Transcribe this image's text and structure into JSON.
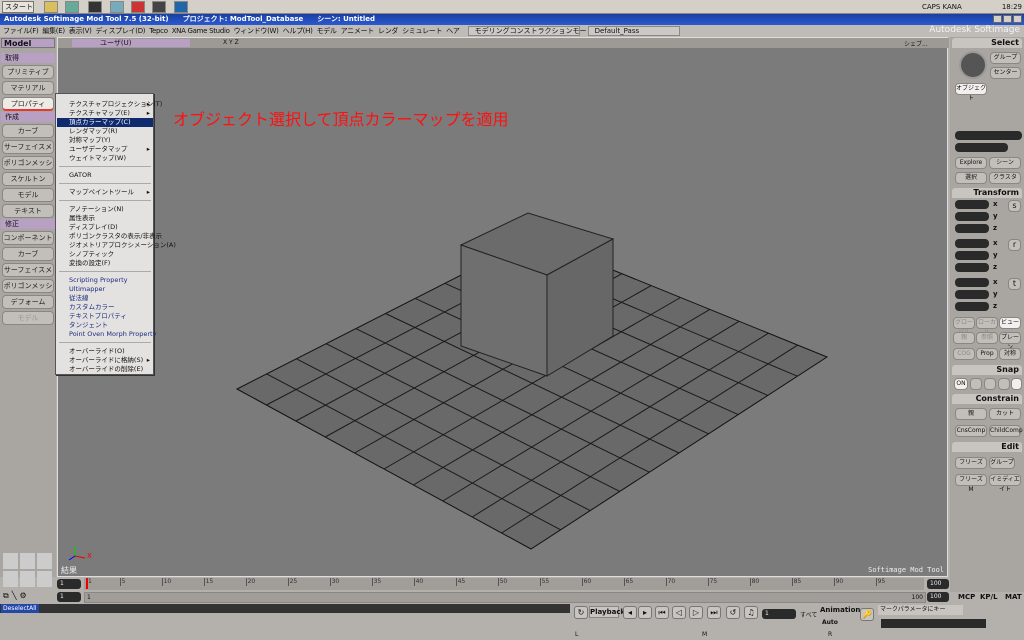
{
  "taskbar": {
    "start": "スタート",
    "time": "18:29",
    "tray": "CAPS KANA"
  },
  "titlebar": {
    "app": "Autodesk Softimage Mod Tool 7.5 (32-bit)",
    "project": "プロジェクト: ModTool_Database",
    "scene": "シーン: Untitled"
  },
  "menubar": {
    "items": [
      "ファイル(F)",
      "編集(E)",
      "表示(V)",
      "ディスプレイ(D)",
      "Tepco",
      "XNA Game Studio",
      "ウィンドウ(W)",
      "ヘルプ(H)",
      "モデル",
      "アニメート",
      "レンダ",
      "シミュレート",
      "ヘア"
    ],
    "mode": "モデリングコンストラクションモード",
    "pass": "Default_Pass",
    "brand": "Autodesk Softimage"
  },
  "left": {
    "module": "Model",
    "sections": [
      {
        "title": "取得",
        "items": [
          "プリミティブ",
          "マテリアル",
          "プロパティ"
        ]
      },
      {
        "title": "作成",
        "items": [
          "カーブ",
          "サーフェイスメッシュ",
          "ポリゴンメッシュ",
          "スケルトン",
          "モデル",
          "テキスト"
        ]
      },
      {
        "title": "修正",
        "items": [
          "コンポーネント",
          "カーブ",
          "サーフェイスメッシュ",
          "ポリゴンメッシュ",
          "デフォーム",
          "モデル"
        ]
      }
    ]
  },
  "viewport": {
    "camera": "ユーザ(U)",
    "axes": "X Y Z",
    "shading": "シェブ...",
    "annotation": "オブジェクト選択して頂点カラーマップを適用",
    "bottom_left": "結果",
    "bottom_right": "Softimage Mod Tool",
    "axis_x": "X"
  },
  "menu": {
    "items": [
      {
        "label": "テクスチャプロジェクション(T)",
        "sub": true
      },
      {
        "label": "テクスチャマップ(E)",
        "sub": true
      },
      {
        "label": "頂点カラーマップ(C)",
        "selected": true
      },
      {
        "label": "レンダマップ(R)"
      },
      {
        "label": "対称マップ(Y)"
      },
      {
        "label": "ユーザデータマップ",
        "sub": true
      },
      {
        "label": "ウェイトマップ(W)"
      },
      {
        "label": "GATOR"
      },
      {
        "label": "マップペイントツール",
        "sub": true
      },
      {
        "label": "アノテーション(N)"
      },
      {
        "label": "属性表示"
      },
      {
        "label": "ディスプレイ(D)"
      },
      {
        "label": "ポリゴンクラスタの表示/非表示"
      },
      {
        "label": "ジオメトリアプロクシメーション(A)"
      },
      {
        "label": "シノプティック"
      },
      {
        "label": "変換の設定(F)"
      },
      {
        "label": "Scripting Property"
      },
      {
        "label": "Ultimapper"
      },
      {
        "label": "従法線"
      },
      {
        "label": "カスタムカラー"
      },
      {
        "label": "テキストプロパティ"
      },
      {
        "label": "タンジェント"
      },
      {
        "label": "Point Oven Morph Property"
      },
      {
        "label": "オーバーライド(O)"
      },
      {
        "label": "オーバーライドに格納(S)",
        "sub": true
      },
      {
        "label": "オーバーライドの削除(E)"
      }
    ]
  },
  "right": {
    "select": {
      "title": "Select",
      "group": "グループ",
      "center": "センター",
      "object": "オブジェクト",
      "explore": "Explore",
      "scene": "シーン",
      "select": "選択",
      "cluster": "クラスタ"
    },
    "transform": {
      "title": "Transform",
      "axes": [
        "x",
        "y",
        "z"
      ],
      "modes": [
        "s",
        "r",
        "t"
      ],
      "global": "グローバル",
      "local": "ローカル",
      "view": "ビュー",
      "parent": "親",
      "ref": "参照",
      "plane": "プレーン",
      "cog": "COG",
      "prop": "Prop",
      "sym": "対称"
    },
    "snap": {
      "title": "Snap",
      "on": "ON"
    },
    "constrain": {
      "title": "Constrain",
      "parent": "親",
      "cut": "カット",
      "cns": "CnsComp",
      "child": "ChildComp"
    },
    "edit": {
      "title": "Edit",
      "freeze": "フリーズ",
      "group": "グループ",
      "freezem": "フリーズ M",
      "immediate": "イミディエイト"
    },
    "tabs": [
      "MCP",
      "KP/L",
      "MAT"
    ]
  },
  "timeline": {
    "ticks": [
      "1",
      "5",
      "10",
      "15",
      "20",
      "25",
      "30",
      "35",
      "40",
      "45",
      "50",
      "55",
      "60",
      "65",
      "70",
      "75",
      "80",
      "85",
      "90",
      "95"
    ],
    "start": "1",
    "end": "100",
    "range_start": "1",
    "range_end": "100",
    "range_label_start": "1",
    "range_label_end": "100"
  },
  "bottom": {
    "command": "DeselectAll",
    "playback": "Playback",
    "frame": "1",
    "all": "すべて",
    "animation": "Animation",
    "auto": "Auto",
    "marked": "マークパラメータにキー",
    "lmr": [
      "L",
      "M",
      "R"
    ]
  }
}
